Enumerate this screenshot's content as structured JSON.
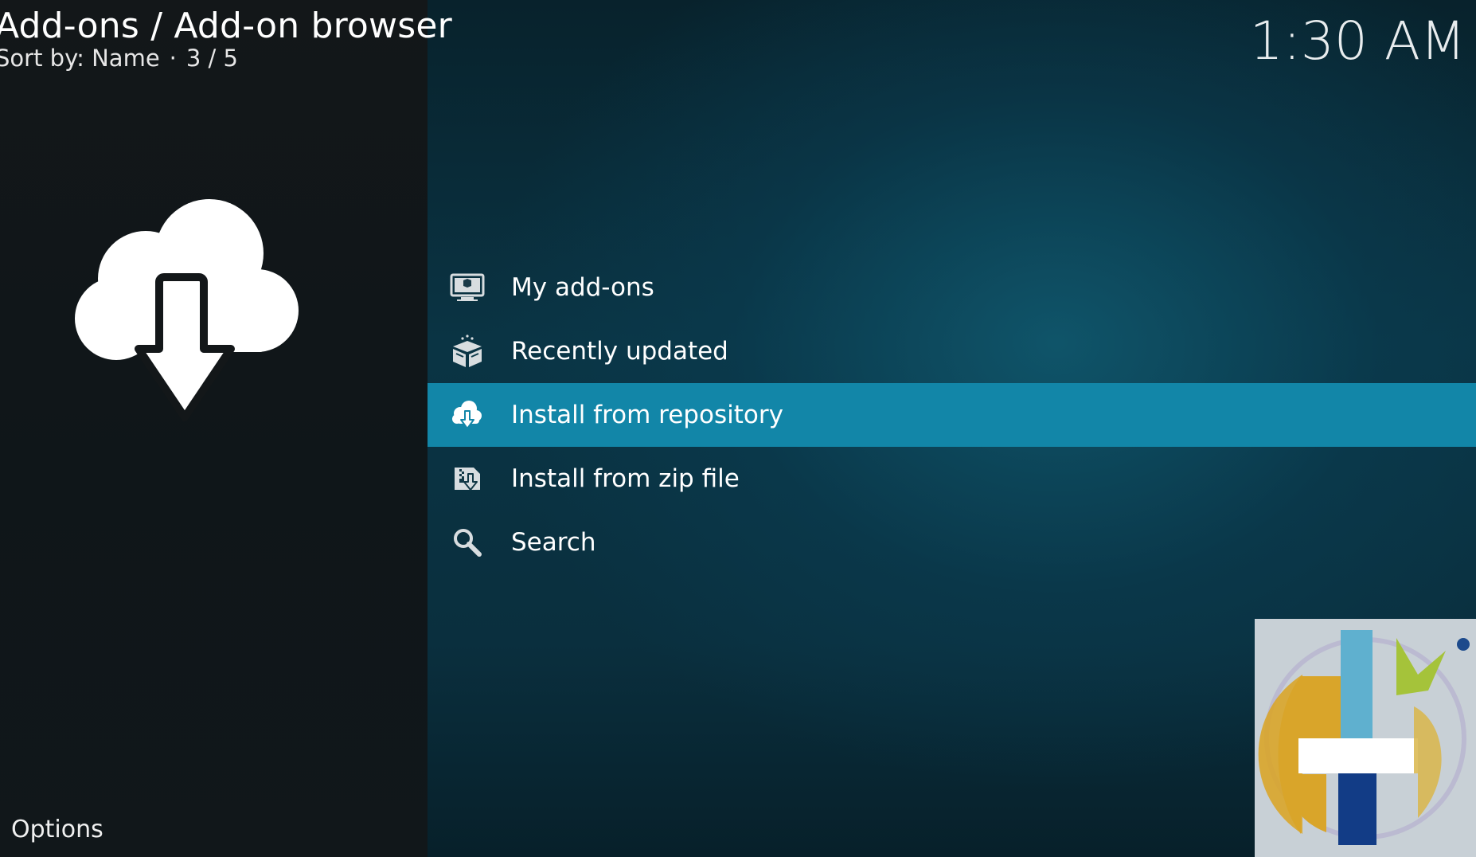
{
  "header": {
    "breadcrumb": "Add-ons / Add-on browser",
    "sort_label": "Sort by: Name",
    "separator": "·",
    "position": "3 / 5"
  },
  "clock": {
    "time": "1:30 AM"
  },
  "preview": {
    "icon": "cloud-download-icon"
  },
  "footer": {
    "options_label": "Options"
  },
  "menu": {
    "items": [
      {
        "label": "My add-ons",
        "icon": "monitor-box-icon",
        "selected": false
      },
      {
        "label": "Recently updated",
        "icon": "open-box-icon",
        "selected": false
      },
      {
        "label": "Install from repository",
        "icon": "cloud-download-icon",
        "selected": true
      },
      {
        "label": "Install from zip file",
        "icon": "zip-install-icon",
        "selected": false
      },
      {
        "label": "Search",
        "icon": "search-icon",
        "selected": false
      }
    ]
  },
  "colors": {
    "selection": "#1286a8",
    "left_panel": "#131719",
    "background": "#0a3444"
  }
}
